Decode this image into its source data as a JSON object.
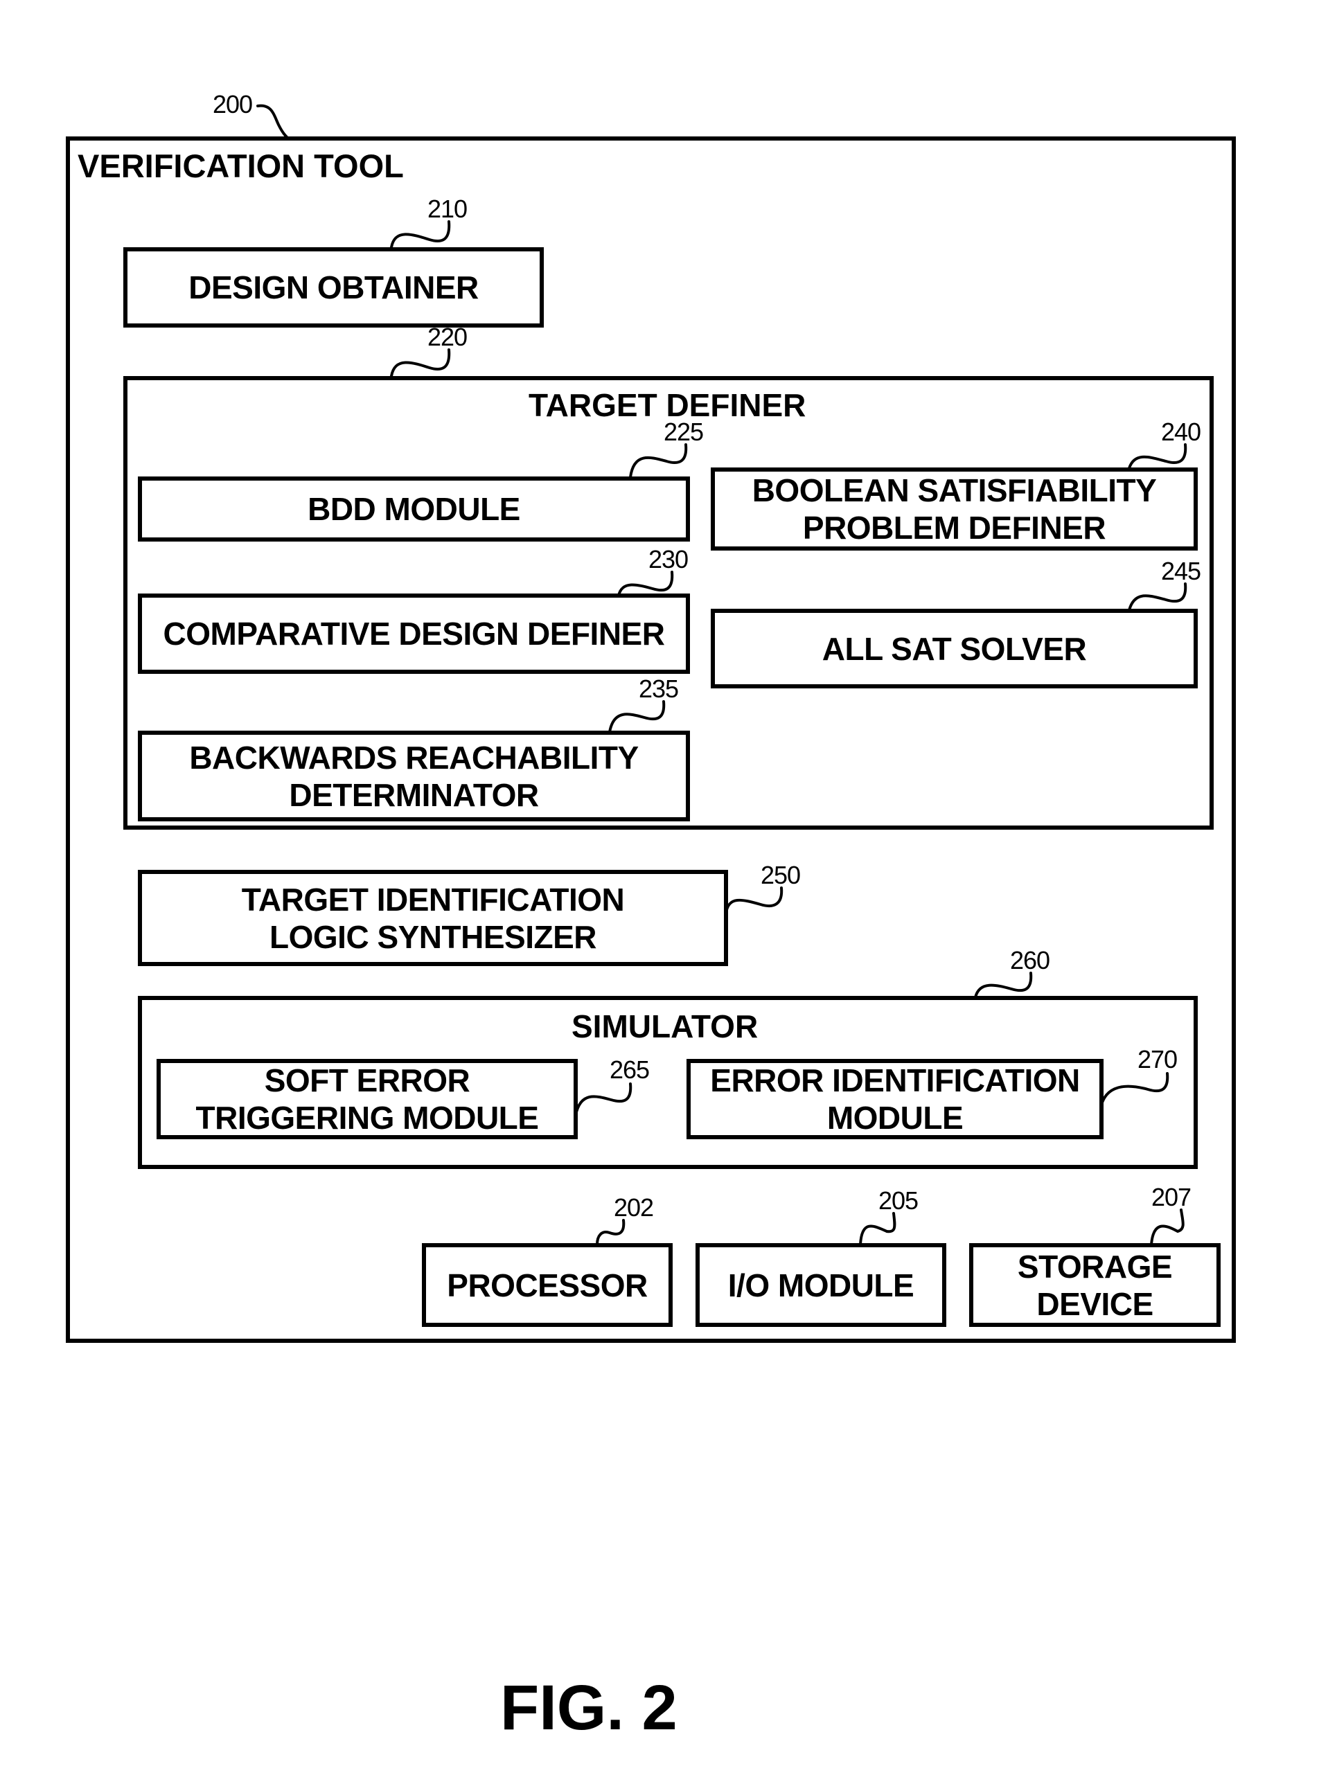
{
  "figure": {
    "caption": "FIG. 2",
    "colors": {
      "line": "#000000",
      "background": "#ffffff"
    }
  },
  "verification_tool": {
    "ref": "200",
    "title": "VERIFICATION TOOL"
  },
  "design_obtainer": {
    "ref": "210",
    "label": "DESIGN OBTAINER"
  },
  "target_definer": {
    "ref": "220",
    "title": "TARGET DEFINER",
    "modules": {
      "bdd": {
        "ref": "225",
        "label": "BDD MODULE"
      },
      "comparative": {
        "ref": "230",
        "label": "COMPARATIVE DESIGN DEFINER"
      },
      "backwards": {
        "ref": "235",
        "label": "BACKWARDS REACHABILITY\nDETERMINATOR"
      },
      "boolean_sat": {
        "ref": "240",
        "label": "BOOLEAN SATISFIABILITY\nPROBLEM DEFINER"
      },
      "all_sat": {
        "ref": "245",
        "label": "ALL SAT SOLVER"
      }
    }
  },
  "target_identification": {
    "ref": "250",
    "label": "TARGET IDENTIFICATION\nLOGIC SYNTHESIZER"
  },
  "simulator": {
    "ref": "260",
    "title": "SIMULATOR",
    "modules": {
      "soft_error": {
        "ref": "265",
        "label": "SOFT ERROR\nTRIGGERING MODULE"
      },
      "error_identification": {
        "ref": "270",
        "label": "ERROR IDENTIFICATION\nMODULE"
      }
    }
  },
  "hardware": {
    "processor": {
      "ref": "202",
      "label": "PROCESSOR"
    },
    "io_module": {
      "ref": "205",
      "label": "I/O MODULE"
    },
    "storage": {
      "ref": "207",
      "label": "STORAGE\nDEVICE"
    }
  }
}
